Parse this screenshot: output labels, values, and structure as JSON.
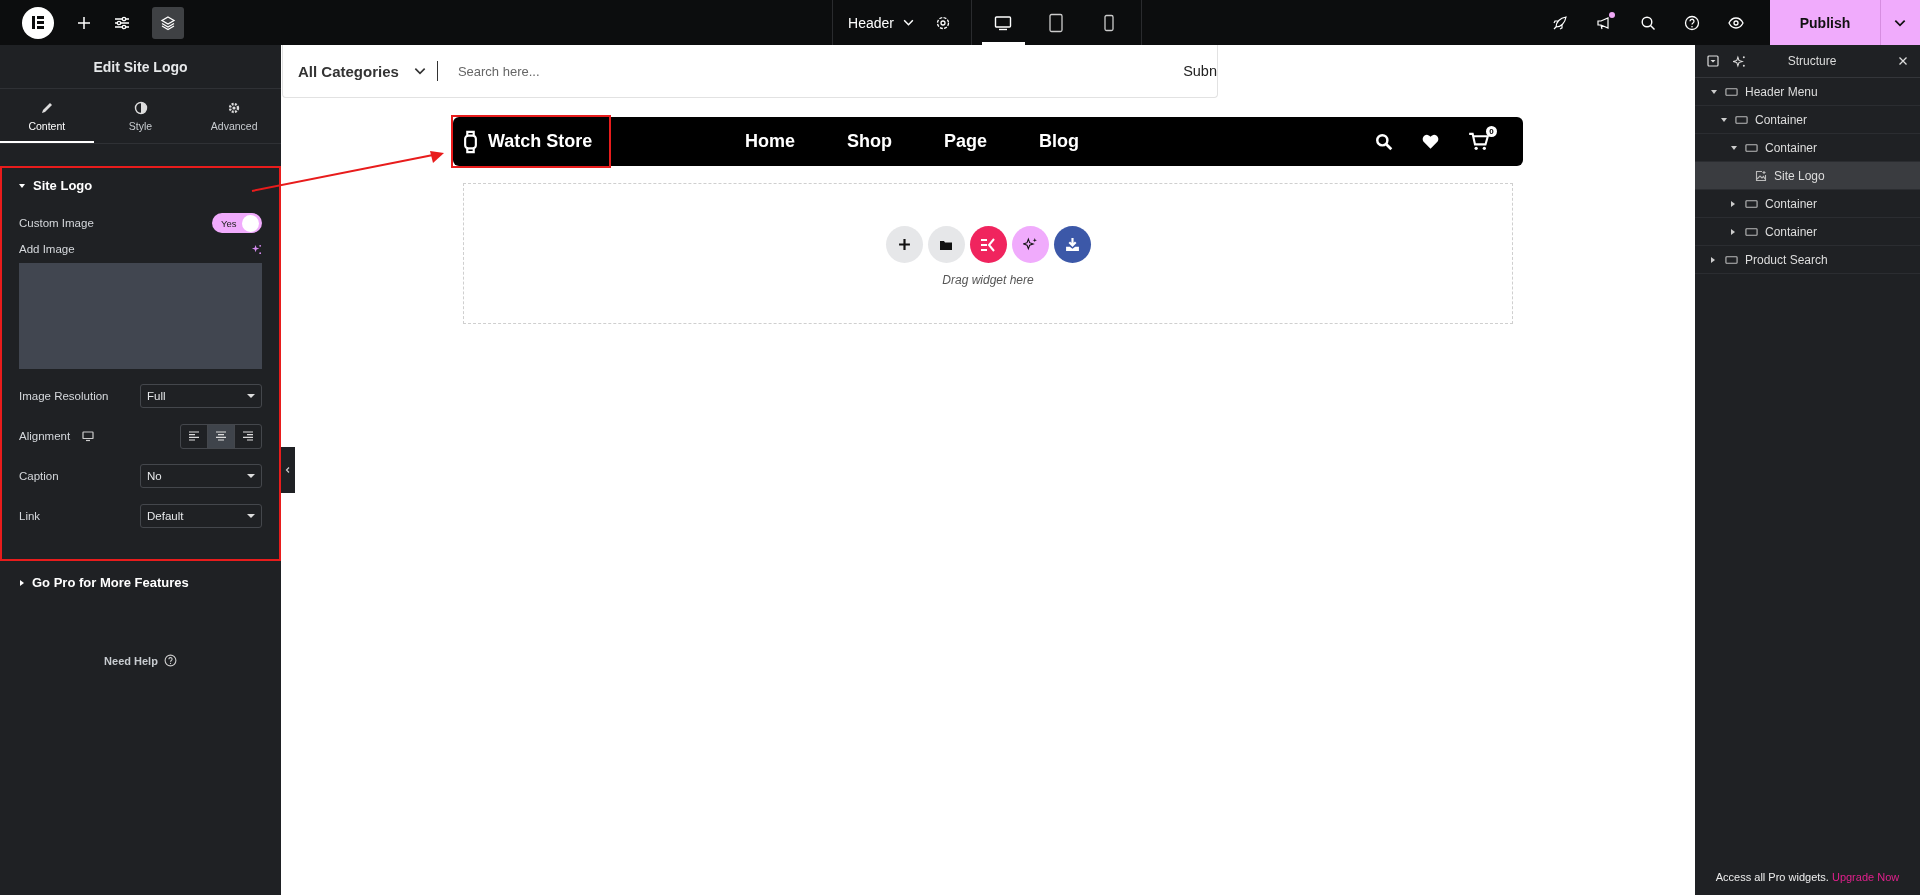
{
  "topbar": {
    "document_title": "Header",
    "devices": [
      {
        "kind": "desktop",
        "selected": true
      },
      {
        "kind": "tablet",
        "selected": false
      },
      {
        "kind": "mobile",
        "selected": false
      }
    ],
    "notification": true,
    "publish": "Publish"
  },
  "left_panel": {
    "title": "Edit Site Logo",
    "tabs": [
      {
        "label": "Content",
        "kind": "content",
        "selected": true
      },
      {
        "label": "Style",
        "kind": "style",
        "selected": false
      },
      {
        "label": "Advanced",
        "kind": "advanced",
        "selected": false
      }
    ],
    "section": {
      "title": "Site Logo",
      "expanded": true,
      "custom_image": {
        "label": "Custom Image",
        "toggle_text": "Yes",
        "on": true
      },
      "add_image": "Add Image",
      "fields": [
        {
          "kind": "select",
          "label": "Image Resolution",
          "value": "Full"
        },
        {
          "kind": "align",
          "label": "Alignment",
          "options": [
            {
              "kind": "left",
              "selected": false
            },
            {
              "kind": "center",
              "selected": true
            },
            {
              "kind": "right",
              "selected": false
            }
          ]
        },
        {
          "kind": "select",
          "label": "Caption",
          "value": "No"
        },
        {
          "kind": "select",
          "label": "Link",
          "value": "Default"
        }
      ]
    },
    "go_pro": {
      "title": "Go Pro for More Features",
      "expanded": false
    },
    "need_help": "Need Help"
  },
  "canvas": {
    "search": {
      "category": "All Categories",
      "placeholder": "Search here...",
      "submit": "Subn"
    },
    "header": {
      "logo_text": "Watch Store",
      "menu": [
        "Home",
        "Shop",
        "Page",
        "Blog"
      ],
      "cart_count": "0"
    },
    "drop_zone": {
      "hint": "Drag widget here"
    }
  },
  "structure": {
    "title": "Structure",
    "tree": [
      {
        "label": "Header Menu",
        "kind": "container",
        "selected": false,
        "expanded": true,
        "children": [
          {
            "label": "Container",
            "kind": "container",
            "selected": false,
            "expanded": true,
            "children": [
              {
                "label": "Container",
                "kind": "container",
                "selected": false,
                "expanded": true,
                "children": [
                  {
                    "label": "Site Logo",
                    "kind": "widget",
                    "selected": true
                  }
                ]
              },
              {
                "label": "Container",
                "kind": "container",
                "selected": false,
                "expanded": false
              },
              {
                "label": "Container",
                "kind": "container",
                "selected": false,
                "expanded": false
              }
            ]
          }
        ]
      },
      {
        "label": "Product Search",
        "kind": "container",
        "selected": false,
        "expanded": false
      }
    ],
    "footer": {
      "text": "Access all Pro widgets.",
      "link": "Upgrade Now"
    }
  }
}
